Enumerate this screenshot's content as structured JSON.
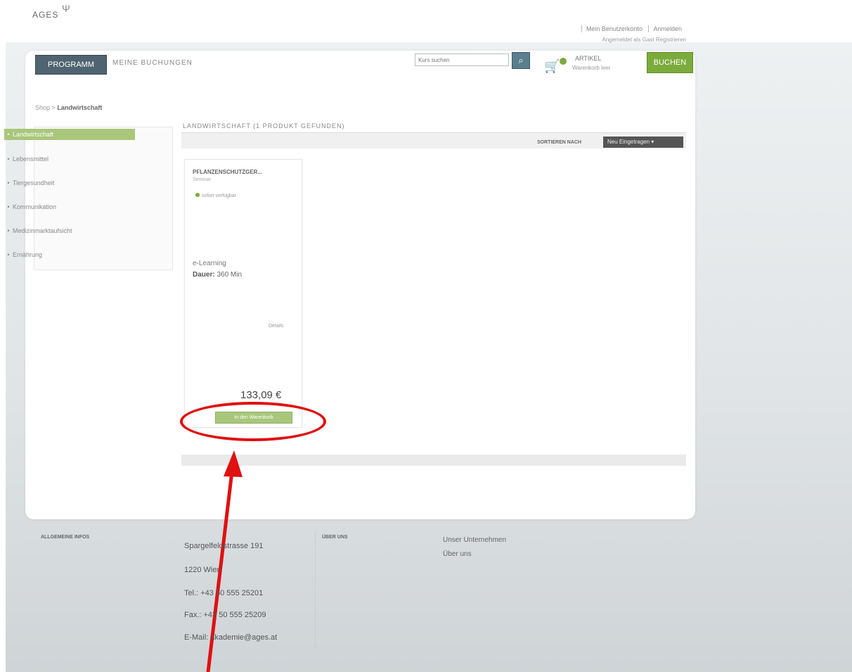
{
  "header": {
    "logo": "AGES",
    "toplinks": [
      "Mein Benutzerkonto",
      "Anmelden"
    ],
    "subline": "Angemeldet als Gast  Registrieren",
    "nav_programm": "PROGRAMM",
    "nav_buchungen": "MEINE BUCHUNGEN",
    "search_placeholder": "Kurs suchen",
    "cart_title": "ARTIKEL",
    "cart_sub": "Warenkorb leer",
    "buchen": "BUCHEN"
  },
  "breadcrumb": {
    "home": "Shop",
    "separator": ">",
    "current": "Landwirtschaft"
  },
  "sidebar": {
    "items": [
      {
        "label": "Landwirtschaft",
        "active": true
      },
      {
        "label": "Lebensmittel",
        "active": false
      },
      {
        "label": "Tiergesundheit",
        "active": false
      },
      {
        "label": "Kommunikation",
        "active": false
      },
      {
        "label": "Medizinmarktaufsicht",
        "active": false
      },
      {
        "label": "Ernährung",
        "active": false
      }
    ]
  },
  "listing": {
    "heading": "LANDWIRTSCHAFT (1 PRODUKT GEFUNDEN)",
    "sort_label": "SORTIEREN NACH",
    "sort_value": "Neu Eingetragen"
  },
  "product": {
    "name": "PFLANZENSCHUTZGER...",
    "subtitle": "Seminar",
    "stock": "sofort verfügbar",
    "type": "e-Learning",
    "dauer_label": "Dauer:",
    "dauer_value": "360 Min",
    "detail_link": "Details",
    "price": "133,09 €",
    "cart_button": "In den Warenkorb"
  },
  "footer": {
    "col1_heading": "ALLGEMEINE INFOS",
    "address": [
      "Spargelfeldstrasse 191",
      "1220 Wien",
      "Tel.: +43 50 555 25201",
      "Fax.: +43 50 555 25209",
      "E-Mail: akademie@ages.at"
    ],
    "col2_heading": "ÜBER UNS",
    "links": [
      "Unser Unternehmen",
      "Über uns"
    ]
  }
}
